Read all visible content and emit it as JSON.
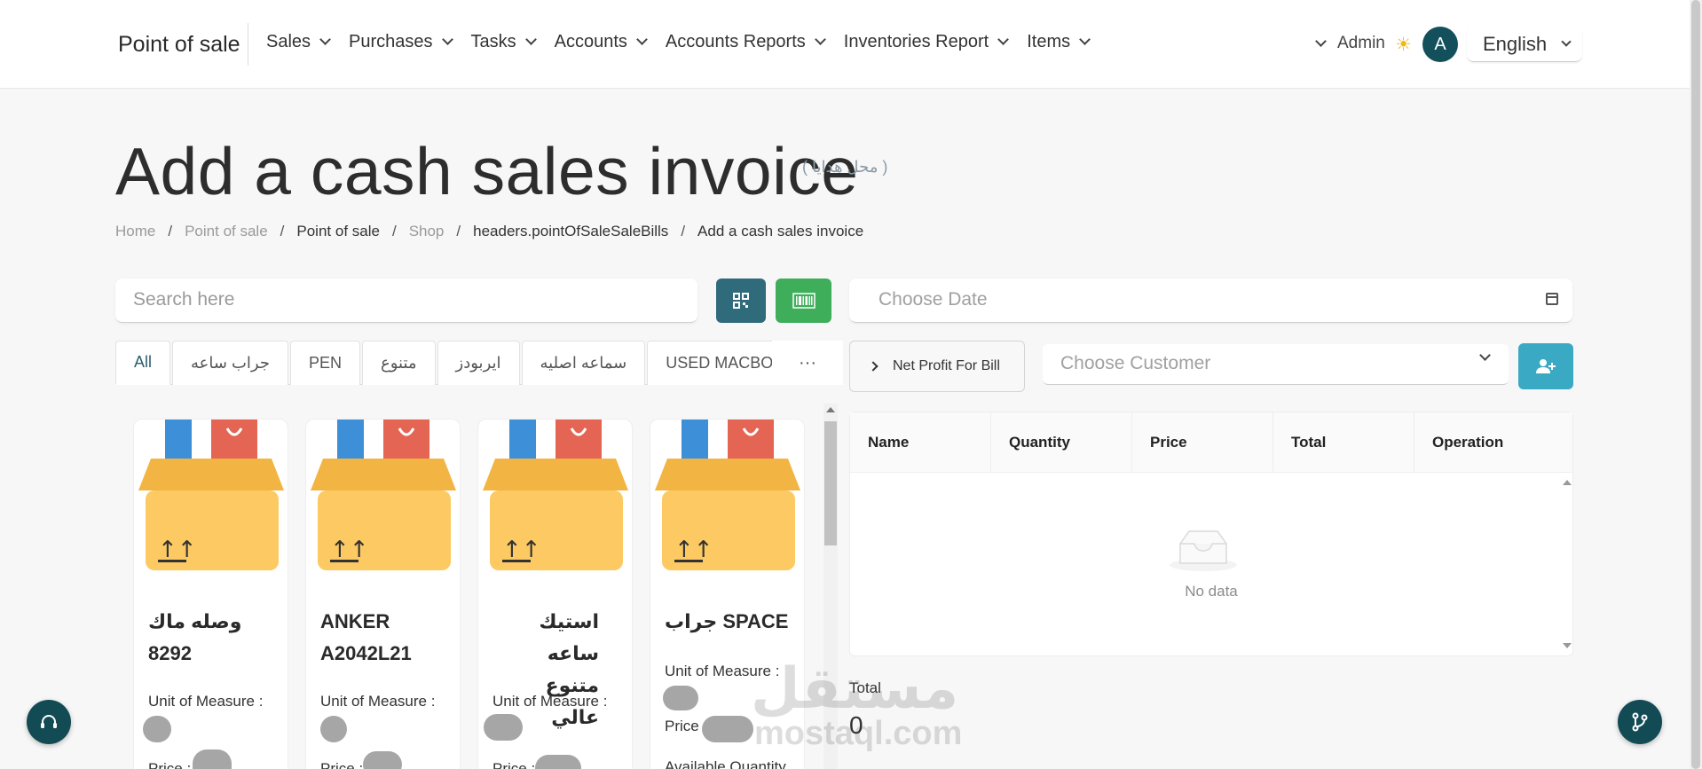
{
  "app": {
    "brand": "Point of sale"
  },
  "nav": [
    {
      "label": "Sales"
    },
    {
      "label": "Purchases"
    },
    {
      "label": "Tasks"
    },
    {
      "label": "Accounts"
    },
    {
      "label": "Accounts Reports"
    },
    {
      "label": "Inventories Report"
    },
    {
      "label": "Items"
    }
  ],
  "user": {
    "name": "Admin",
    "avatar_letter": "A",
    "language": "English"
  },
  "page": {
    "title": "Add a cash sales invoice",
    "subtitle": "( محل هدايا )"
  },
  "breadcrumb": [
    {
      "label": "Home",
      "muted": true
    },
    {
      "label": "Point of sale",
      "muted": true
    },
    {
      "label": "Point of sale",
      "muted": false
    },
    {
      "label": "Shop",
      "muted": true
    },
    {
      "label": "headers.pointOfSaleSaleBills",
      "muted": false
    },
    {
      "label": "Add a cash sales invoice",
      "muted": false
    }
  ],
  "search": {
    "placeholder": "Search here"
  },
  "categories": {
    "active": "All",
    "items": [
      "All",
      "جراب ساعه",
      "PEN",
      "متنوع",
      "ايربودز",
      "سماعه اصليه",
      "USED MACBOOK"
    ],
    "more": "···"
  },
  "products": [
    {
      "name": "وصله ماك 8292",
      "unit_label": "Unit of Measure :",
      "price_label": "Price :"
    },
    {
      "name": "ANKER A2042L21",
      "unit_label": "Unit of Measure :",
      "price_label": "Price :"
    },
    {
      "name": "استيك ساعه متنوع عالي",
      "unit_label": "Unit of Measure :",
      "price_label": "Price :"
    },
    {
      "name": "جراب SPACE",
      "unit_label": "Unit of Measure :",
      "price_label": "Price :",
      "qty_label": "Available Quantity"
    }
  ],
  "invoice": {
    "date_placeholder": "Choose Date",
    "net_profit_label": "Net Profit For Bill",
    "customer_placeholder": "Choose Customer",
    "columns": [
      "Name",
      "Quantity",
      "Price",
      "Total",
      "Operation"
    ],
    "empty_text": "No data",
    "total_label": "Total",
    "total_value": "0"
  },
  "watermark": {
    "arabic": "مستقل",
    "latin": "mostaql.com"
  },
  "colors": {
    "primary": "#2f6b7a",
    "success": "#3fae5a",
    "info": "#3aa9c4",
    "dark_teal": "#134b55"
  }
}
